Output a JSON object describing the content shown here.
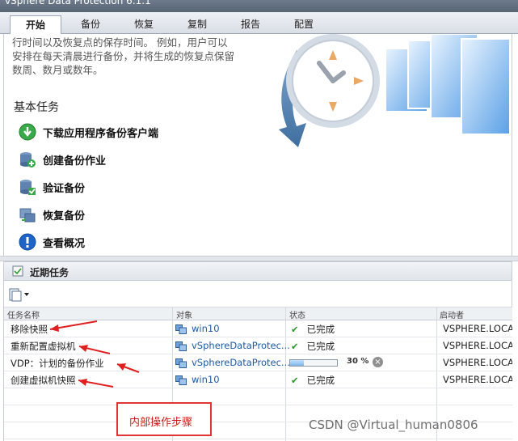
{
  "window": {
    "title": "vSphere Data Protection 6.1.1"
  },
  "tabs": [
    {
      "label": "开始",
      "active": true
    },
    {
      "label": "备份",
      "active": false
    },
    {
      "label": "恢复",
      "active": false
    },
    {
      "label": "复制",
      "active": false
    },
    {
      "label": "报告",
      "active": false
    },
    {
      "label": "配置",
      "active": false
    }
  ],
  "start_panel": {
    "description_lines": [
      "行时间以及恢复点的保存时间。 例如，用户可以",
      "安排在每天清晨进行备份，并将生成的恢复点保留",
      "数周、数月或数年。"
    ],
    "basic_tasks_title": "基本任务",
    "tasks": [
      {
        "label": "下载应用程序备份客户端",
        "icon": "download-icon"
      },
      {
        "label": "创建备份作业",
        "icon": "create-backup-icon"
      },
      {
        "label": "验证备份",
        "icon": "verify-backup-icon"
      },
      {
        "label": "恢复备份",
        "icon": "restore-backup-icon"
      },
      {
        "label": "查看概况",
        "icon": "info-icon"
      }
    ]
  },
  "recent_tasks": {
    "title": "近期任务",
    "columns": [
      "任务名称",
      "对象",
      "状态",
      "启动者"
    ],
    "rows": [
      {
        "task": "移除快照",
        "object": "win10",
        "status": "已完成",
        "initiator": "VSPHERE.LOCA"
      },
      {
        "task": "重新配置虚拟机",
        "object": "vSphereDataProtec...",
        "status": "已完成",
        "initiator": "VSPHERE.LOCA"
      },
      {
        "task": "VDP：计划的备份作业",
        "object": "vSphereDataProtec...",
        "status": "30 %",
        "progress": 0.3,
        "initiator": "VSPHERE.LOCA"
      },
      {
        "task": "创建虚拟机快照",
        "object": "win10",
        "status": "已完成",
        "initiator": "VSPHERE.LOCA"
      }
    ]
  },
  "annotation": {
    "label": "内部操作步骤",
    "color": "#e03535"
  },
  "watermark": "CSDN @Virtual_human0806",
  "colors": {
    "accent": "#1f5aa6",
    "success": "#2a9a2a",
    "arrow": "#e02020"
  }
}
